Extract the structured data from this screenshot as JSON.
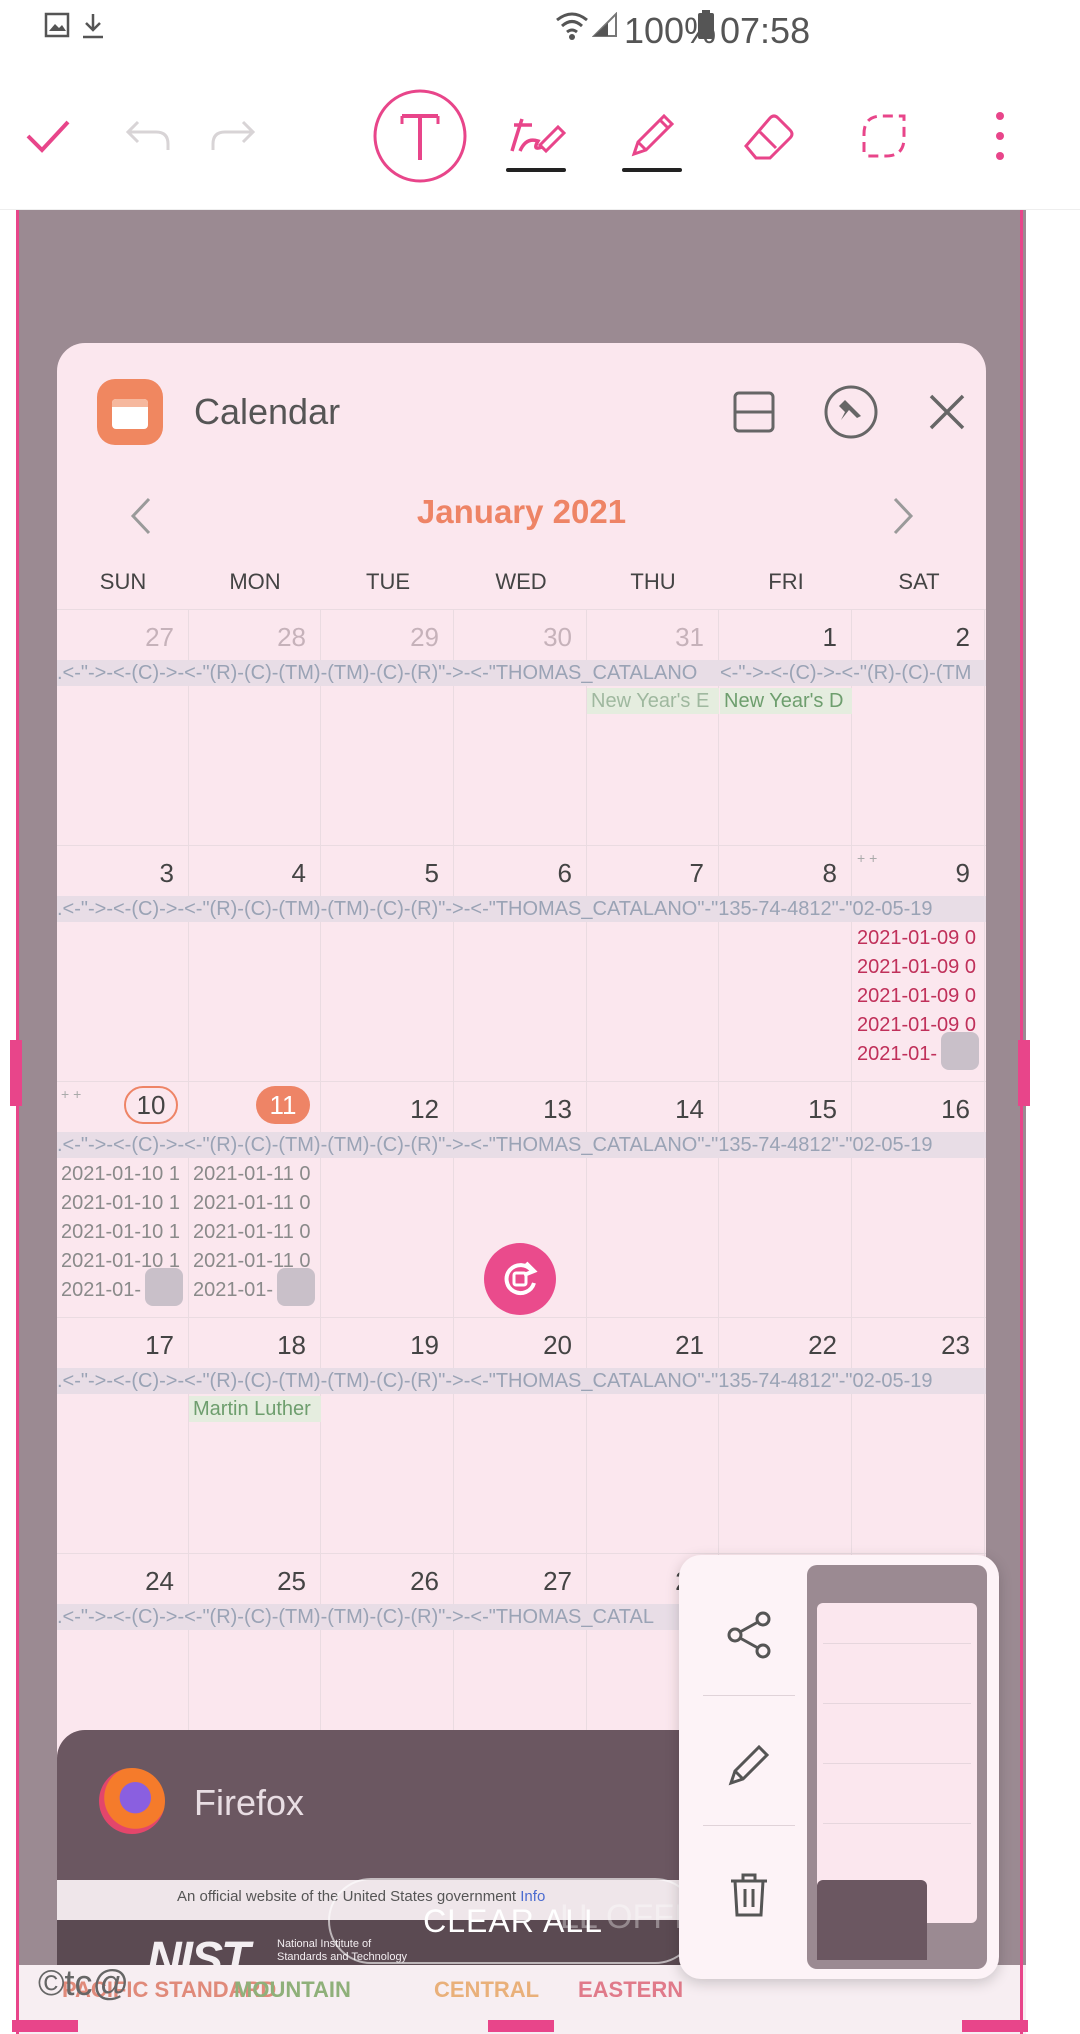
{
  "status_bar": {
    "battery": "100%",
    "time": "07:58"
  },
  "toolbar": {
    "buttons": [
      "done-check",
      "undo",
      "redo",
      "text-tool",
      "handwriting-pen",
      "pencil",
      "eraser",
      "lasso-select",
      "more-options"
    ]
  },
  "calendar_app": {
    "title": "Calendar",
    "month_label": "January 2021",
    "weekdays": [
      "SUN",
      "MON",
      "TUE",
      "WED",
      "THU",
      "FRI",
      "SAT"
    ],
    "weeks": [
      {
        "days": [
          "27",
          "28",
          "29",
          "30",
          "31",
          "1",
          "2"
        ]
      },
      {
        "days": [
          "3",
          "4",
          "5",
          "6",
          "7",
          "8",
          "9"
        ]
      },
      {
        "days": [
          "10",
          "11",
          "12",
          "13",
          "14",
          "15",
          "16"
        ]
      },
      {
        "days": [
          "17",
          "18",
          "19",
          "20",
          "21",
          "22",
          "23"
        ]
      },
      {
        "days": [
          "24",
          "25",
          "26",
          "27",
          "28",
          "29",
          "30"
        ]
      }
    ],
    "event_strip_text": {
      "w0": ".<-\"->-<-(C)->-<-\"(R)-(C)-(TM)-(TM)-(C)-(R)\"->-<-\"THOMAS_CATALANO",
      "w0b": "<-\"->-<-(C)->-<-\"(R)-(C)-(TM",
      "full": ".<-\"->-<-(C)->-<-\"(R)-(C)-(TM)-(TM)-(C)-(R)\"->-<-\"THOMAS_CATALANO\"-\"135-74-4812\"-\"02-05-19",
      "w4": ".<-\"->-<-(C)->-<-\"(R)-(C)-(TM)-(TM)-(C)-(R)\"->-<-\"THOMAS_CATAL"
    },
    "holidays": {
      "new_years_eve": "New Year's E",
      "new_years_day": "New Year's D",
      "mlk": "Martin Luther"
    },
    "events": {
      "jan9": [
        "2021-01-09 0",
        "2021-01-09 0",
        "2021-01-09 0",
        "2021-01-09 0",
        "2021-01-"
      ],
      "jan10": [
        "2021-01-10 1",
        "2021-01-10 1",
        "2021-01-10 1",
        "2021-01-10 1",
        "2021-01-"
      ],
      "jan11": [
        "2021-01-11 0",
        "2021-01-11 0",
        "2021-01-11 0",
        "2021-01-11 0",
        "2021-01-"
      ]
    },
    "today": "10",
    "selected": "11"
  },
  "firefox_app": {
    "title": "Firefox",
    "banner_text": "An official website of the United States government",
    "banner_link": "Info",
    "nist_logo": "NIST",
    "nist_subtitle": "National Institute of Standards and Technology U.S. Department of Commerce"
  },
  "clear_all_label": "CLEAR ALL",
  "ghost_text": "LL OFFICIAL U",
  "timezones": [
    {
      "name": "PACIFIC STANDARD",
      "color": "#e08a7a"
    },
    {
      "name": "MOUNTAIN",
      "color": "#8fb07a"
    },
    {
      "name": "CENTRAL",
      "color": "#e9b07a"
    },
    {
      "name": "EASTERN",
      "color": "#e07a8a"
    }
  ],
  "watermark": "©tc@",
  "fab_actions": [
    "share",
    "edit",
    "delete"
  ],
  "accent_color": "#e8458a"
}
